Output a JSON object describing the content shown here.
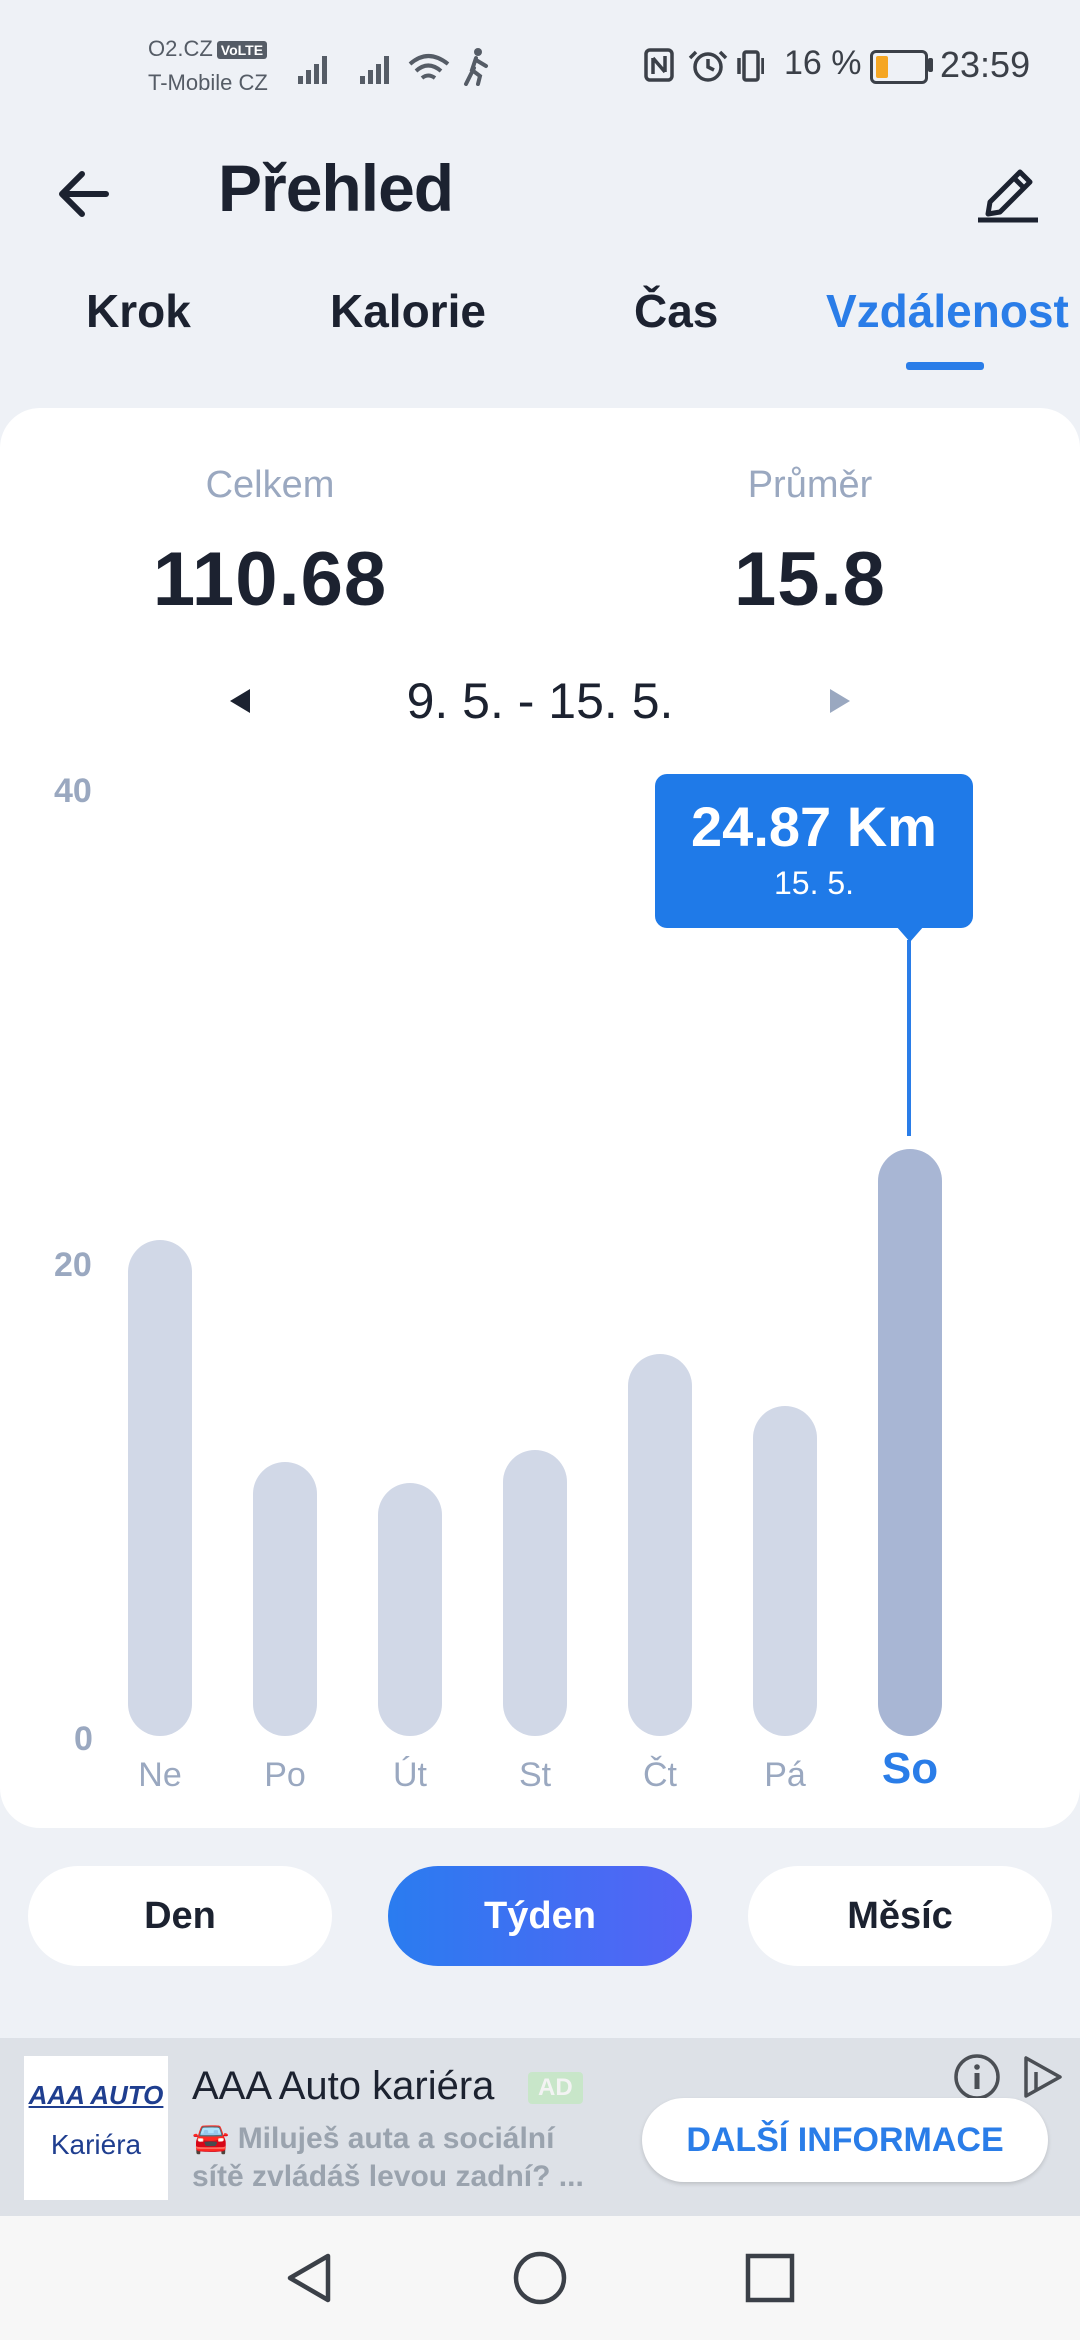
{
  "status_bar": {
    "carrier1": "O2.CZ",
    "volte": "VoLTE",
    "carrier2": "T-Mobile CZ",
    "battery_pct": "16 %",
    "time": "23:59"
  },
  "header": {
    "title": "Přehled",
    "tabs": [
      {
        "label": "Krok"
      },
      {
        "label": "Kalorie"
      },
      {
        "label": "Čas"
      },
      {
        "label": "Vzdálenost",
        "active": true
      }
    ]
  },
  "summary": {
    "total_label": "Celkem",
    "total_value": "110.68",
    "avg_label": "Průměr",
    "avg_value": "15.8"
  },
  "range": {
    "label": "9. 5. - 15. 5."
  },
  "tooltip": {
    "value": "24.87 Km",
    "date": "15. 5."
  },
  "chart_data": {
    "type": "bar",
    "categories": [
      "Ne",
      "Po",
      "Út",
      "St",
      "Čt",
      "Pá",
      "So"
    ],
    "values": [
      21.0,
      11.6,
      10.7,
      12.1,
      16.2,
      14.0,
      24.87
    ],
    "ylim": [
      0,
      40
    ],
    "yticks": [
      "0",
      "20",
      "40"
    ],
    "selected_index": 6,
    "colors": {
      "bar": "#d1d8e7",
      "selected_bar": "#a8b6d4",
      "accent": "#2a7de8"
    }
  },
  "period": {
    "day": "Den",
    "week": "Týden",
    "month": "Měsíc",
    "active": "week"
  },
  "ad": {
    "logo_top": "AAA AUTO",
    "logo_bottom": "Kariéra",
    "title": "AAA Auto kariéra",
    "badge": "AD",
    "desc_line1": "🚘 Miluješ auta a sociální",
    "desc_line2": "sítě zvládáš levou zadní? ...",
    "cta": "DALŠÍ INFORMACE"
  }
}
